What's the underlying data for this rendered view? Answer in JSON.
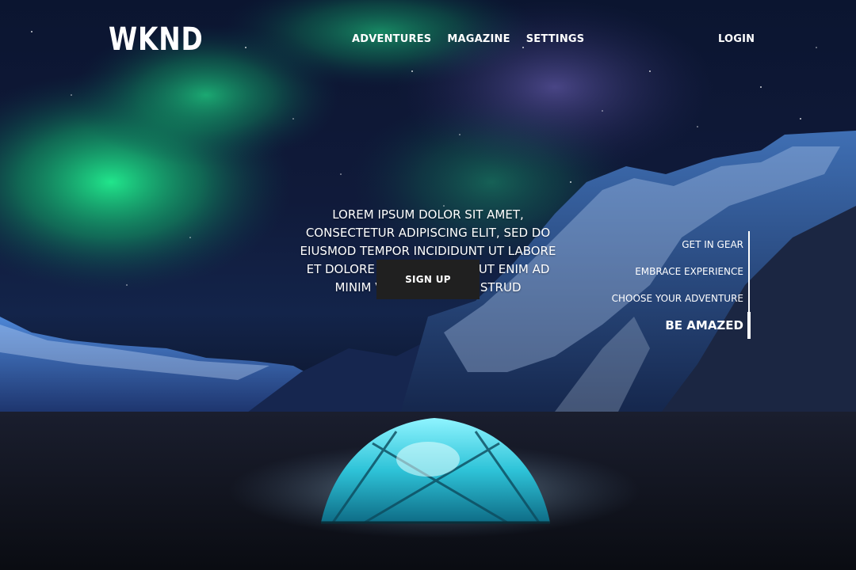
{
  "header": {
    "logo": "WKND",
    "nav": [
      "ADVENTURES",
      "MAGAZINE",
      "SETTINGS"
    ],
    "login": "LOGIN"
  },
  "hero": {
    "tagline": "LOREM IPSUM DOLOR SIT AMET, CONSECTETUR ADIPISCING ELIT, SED DO EIUSMOD TEMPOR INCIDIDUNT UT LABORE ET DOLORE MAGNA ALIQUA. UT ENIM AD MINIM VENIAM, QUIS NOSTRUD",
    "signup": "SIGN UP"
  },
  "side_nav": {
    "items": [
      "GET IN GEAR",
      "EMBRACE EXPERIENCE",
      "CHOOSE YOUR ADVENTURE",
      "BE AMAZED"
    ],
    "active_index": 3
  },
  "colors": {
    "aurora": "#1fe08a",
    "button_bg": "#202020",
    "tent": "#3ad6e6"
  }
}
